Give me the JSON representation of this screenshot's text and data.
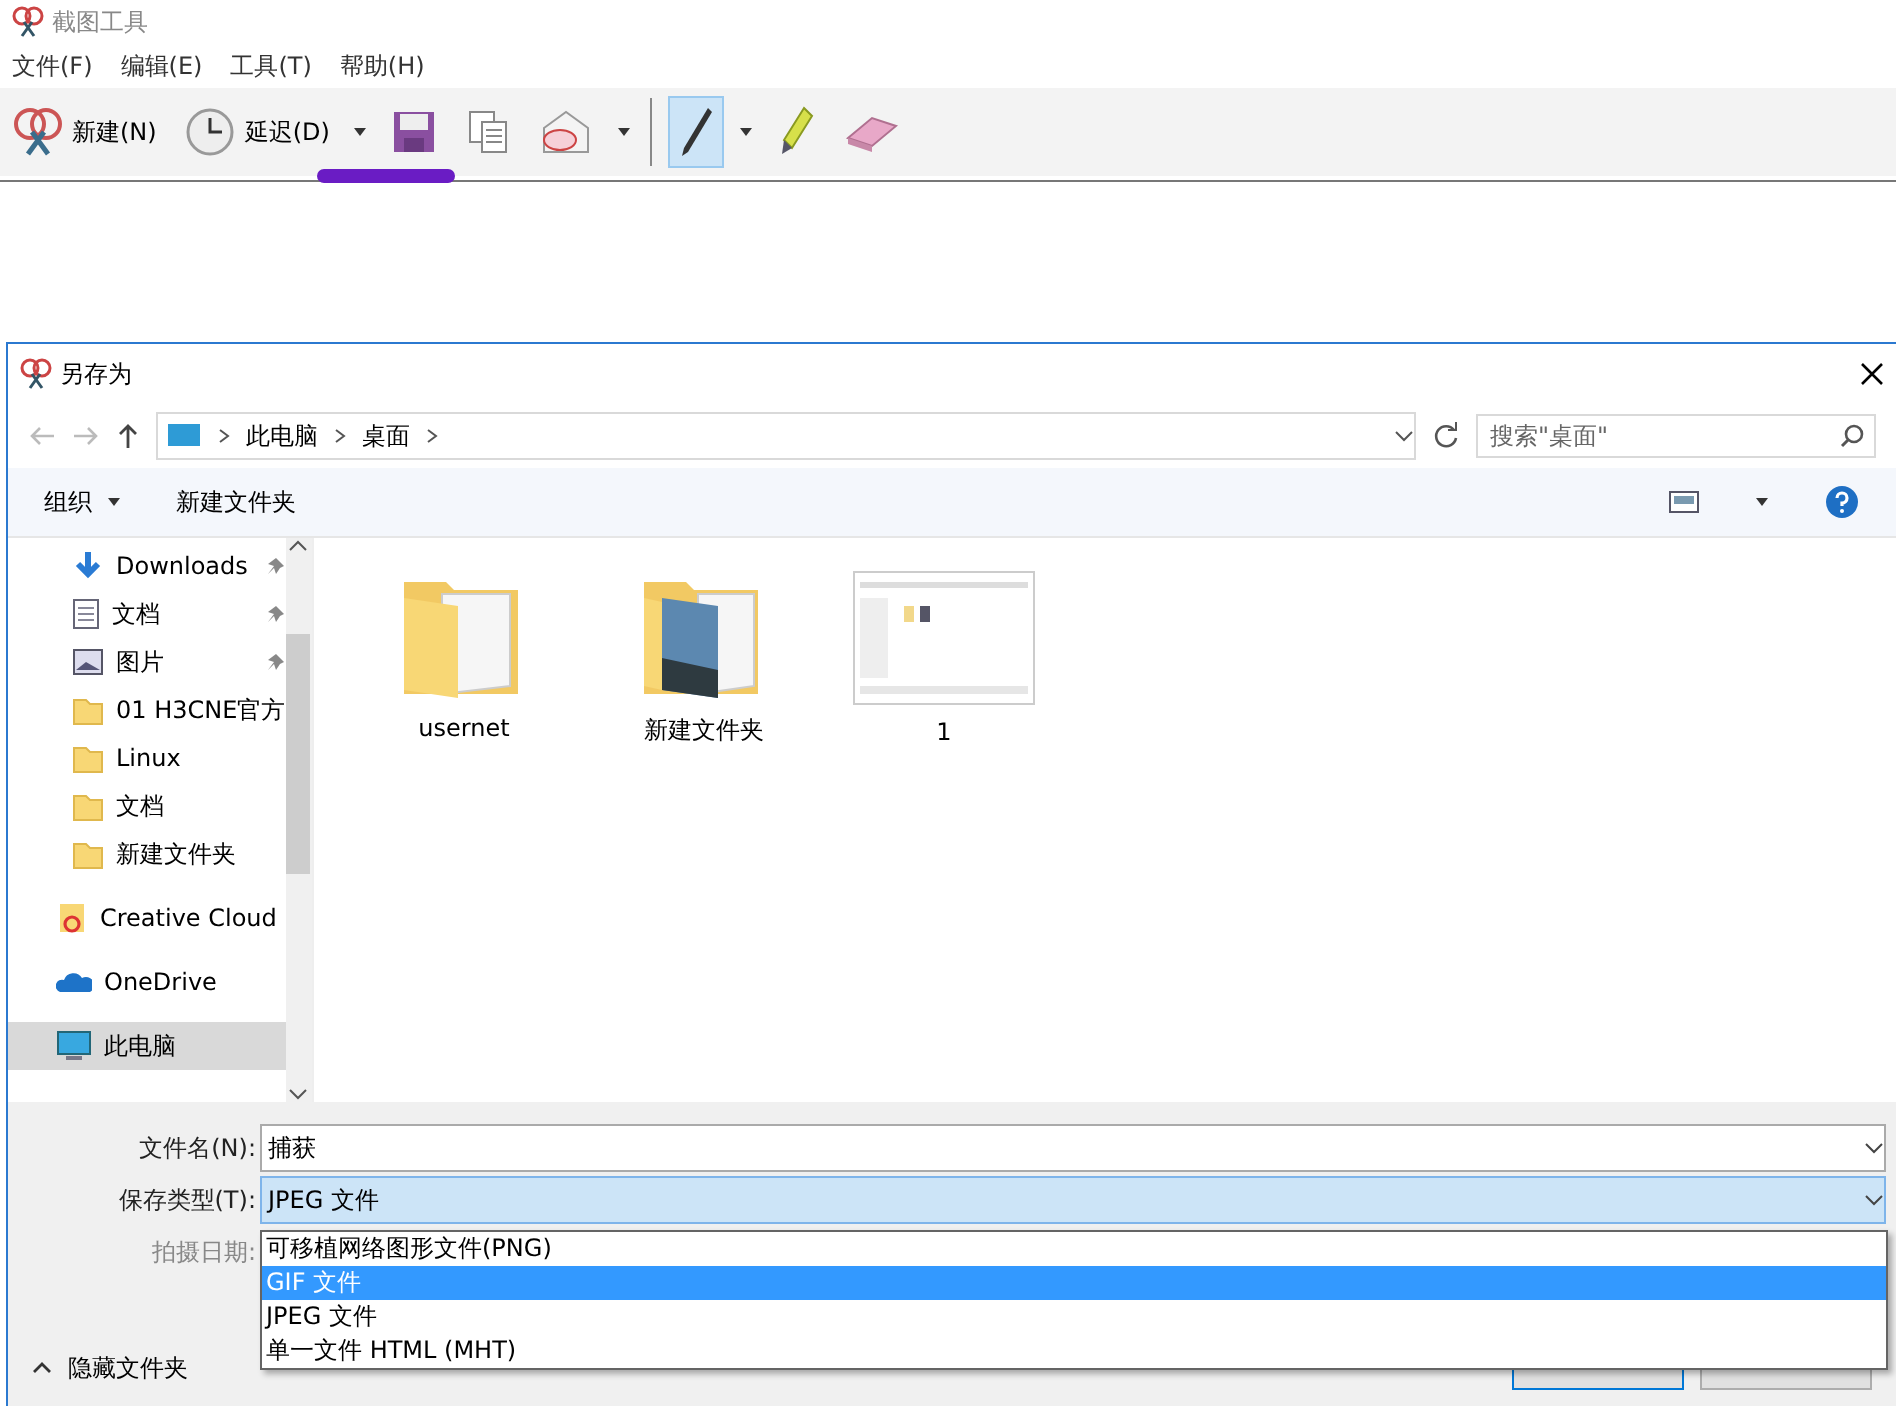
{
  "app": {
    "title": "截图工具",
    "menu": [
      "文件(F)",
      "编辑(E)",
      "工具(T)",
      "帮助(H)"
    ],
    "toolbar": [
      {
        "kind": "new",
        "label": "新建(N)"
      },
      {
        "kind": "delay",
        "label": "延迟(D)"
      },
      {
        "kind": "save"
      },
      {
        "kind": "copy"
      },
      {
        "kind": "send"
      },
      {
        "kind": "pen",
        "selected": true
      },
      {
        "kind": "highlighter",
        "selected": false
      },
      {
        "kind": "eraser",
        "selected": false
      }
    ]
  },
  "dialog": {
    "title": "另存为",
    "breadcrumb": [
      "此电脑",
      "桌面"
    ],
    "search": {
      "placeholder": "搜索\"桌面\""
    },
    "organize": "组织",
    "new_folder": "新建文件夹",
    "sidebar": [
      {
        "kind": "download",
        "label": "Downloads",
        "pinned": true,
        "selected": false
      },
      {
        "kind": "document",
        "label": "文档",
        "pinned": true,
        "selected": false
      },
      {
        "kind": "picture",
        "label": "图片",
        "pinned": true,
        "selected": false
      },
      {
        "kind": "folder",
        "label": "01 H3CNE官方",
        "pinned": false,
        "selected": false
      },
      {
        "kind": "folder",
        "label": "Linux",
        "pinned": false,
        "selected": false
      },
      {
        "kind": "folder",
        "label": "文档",
        "pinned": false,
        "selected": false
      },
      {
        "kind": "folder",
        "label": "新建文件夹",
        "pinned": false,
        "selected": false
      },
      {
        "kind": "cloud-app",
        "label": "Creative Cloud",
        "pinned": false,
        "selected": false
      },
      {
        "kind": "onedrive",
        "label": "OneDrive",
        "pinned": false,
        "selected": false
      },
      {
        "kind": "computer",
        "label": "此电脑",
        "pinned": false,
        "selected": true
      }
    ],
    "files": [
      {
        "kind": "folder",
        "name": "usernet"
      },
      {
        "kind": "folder-photo",
        "name": "新建文件夹"
      },
      {
        "kind": "screenshot",
        "name": "1"
      }
    ],
    "fields": [
      {
        "kind": "combo",
        "label": "文件名(N):",
        "value": "捕获"
      },
      {
        "kind": "select",
        "label": "保存类型(T):",
        "value": "JPEG 文件"
      },
      {
        "kind": "disabled",
        "label": "拍摄日期:"
      }
    ],
    "options": [
      {
        "label": "可移植网络图形文件(PNG)",
        "selected": false
      },
      {
        "label": "GIF 文件",
        "selected": true
      },
      {
        "label": "JPEG 文件",
        "selected": false
      },
      {
        "label": "单一文件 HTML (MHT)",
        "selected": false
      }
    ],
    "hide_folders": "隐藏文件夹"
  }
}
